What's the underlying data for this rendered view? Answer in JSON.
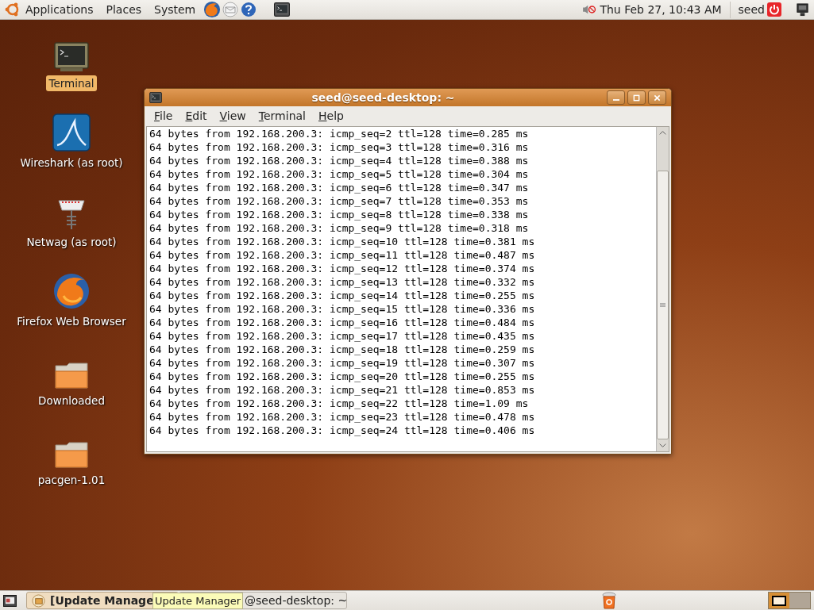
{
  "top_panel": {
    "menus": [
      {
        "label": "Applications"
      },
      {
        "label": "Places"
      },
      {
        "label": "System"
      }
    ],
    "clock": "Thu Feb 27, 10:43 AM",
    "user": "seed"
  },
  "desktop_icons": [
    {
      "kind": "terminal",
      "label": "Terminal",
      "selected": true
    },
    {
      "kind": "wireshark",
      "label": "Wireshark (as root)",
      "selected": false
    },
    {
      "kind": "netwag",
      "label": "Netwag (as root)",
      "selected": false
    },
    {
      "kind": "firefox",
      "label": "Firefox Web Browser",
      "selected": false
    },
    {
      "kind": "folder",
      "label": "Downloaded",
      "selected": false
    },
    {
      "kind": "folder",
      "label": "pacgen-1.01",
      "selected": false
    }
  ],
  "window": {
    "title": "seed@seed-desktop: ~",
    "menu": [
      {
        "label": "File",
        "mnemonic_underlined": true
      },
      {
        "label": "Edit",
        "mnemonic_underlined": true
      },
      {
        "label": "View",
        "mnemonic_underlined": true
      },
      {
        "label": "Terminal",
        "mnemonic_underlined": true
      },
      {
        "label": "Help",
        "mnemonic_underlined": true
      }
    ],
    "lines": [
      "64 bytes from 192.168.200.3: icmp_seq=2 ttl=128 time=0.285 ms",
      "64 bytes from 192.168.200.3: icmp_seq=3 ttl=128 time=0.316 ms",
      "64 bytes from 192.168.200.3: icmp_seq=4 ttl=128 time=0.388 ms",
      "64 bytes from 192.168.200.3: icmp_seq=5 ttl=128 time=0.304 ms",
      "64 bytes from 192.168.200.3: icmp_seq=6 ttl=128 time=0.347 ms",
      "64 bytes from 192.168.200.3: icmp_seq=7 ttl=128 time=0.353 ms",
      "64 bytes from 192.168.200.3: icmp_seq=8 ttl=128 time=0.338 ms",
      "64 bytes from 192.168.200.3: icmp_seq=9 ttl=128 time=0.318 ms",
      "64 bytes from 192.168.200.3: icmp_seq=10 ttl=128 time=0.381 ms",
      "64 bytes from 192.168.200.3: icmp_seq=11 ttl=128 time=0.487 ms",
      "64 bytes from 192.168.200.3: icmp_seq=12 ttl=128 time=0.374 ms",
      "64 bytes from 192.168.200.3: icmp_seq=13 ttl=128 time=0.332 ms",
      "64 bytes from 192.168.200.3: icmp_seq=14 ttl=128 time=0.255 ms",
      "64 bytes from 192.168.200.3: icmp_seq=15 ttl=128 time=0.336 ms",
      "64 bytes from 192.168.200.3: icmp_seq=16 ttl=128 time=0.484 ms",
      "64 bytes from 192.168.200.3: icmp_seq=17 ttl=128 time=0.435 ms",
      "64 bytes from 192.168.200.3: icmp_seq=18 ttl=128 time=0.259 ms",
      "64 bytes from 192.168.200.3: icmp_seq=19 ttl=128 time=0.307 ms",
      "64 bytes from 192.168.200.3: icmp_seq=20 ttl=128 time=0.255 ms",
      "64 bytes from 192.168.200.3: icmp_seq=21 ttl=128 time=0.853 ms",
      "64 bytes from 192.168.200.3: icmp_seq=22 ttl=128 time=1.09 ms",
      "64 bytes from 192.168.200.3: icmp_seq=23 ttl=128 time=0.478 ms",
      "64 bytes from 192.168.200.3: icmp_seq=24 ttl=128 time=0.406 ms"
    ]
  },
  "taskbar": {
    "tasks": [
      {
        "label": "[Update Manage"
      },
      {
        "label": "@seed-desktop: ~"
      }
    ],
    "tooltip": "Update Manager",
    "workspaces": [
      {
        "selected": true
      },
      {
        "selected": false
      }
    ]
  }
}
